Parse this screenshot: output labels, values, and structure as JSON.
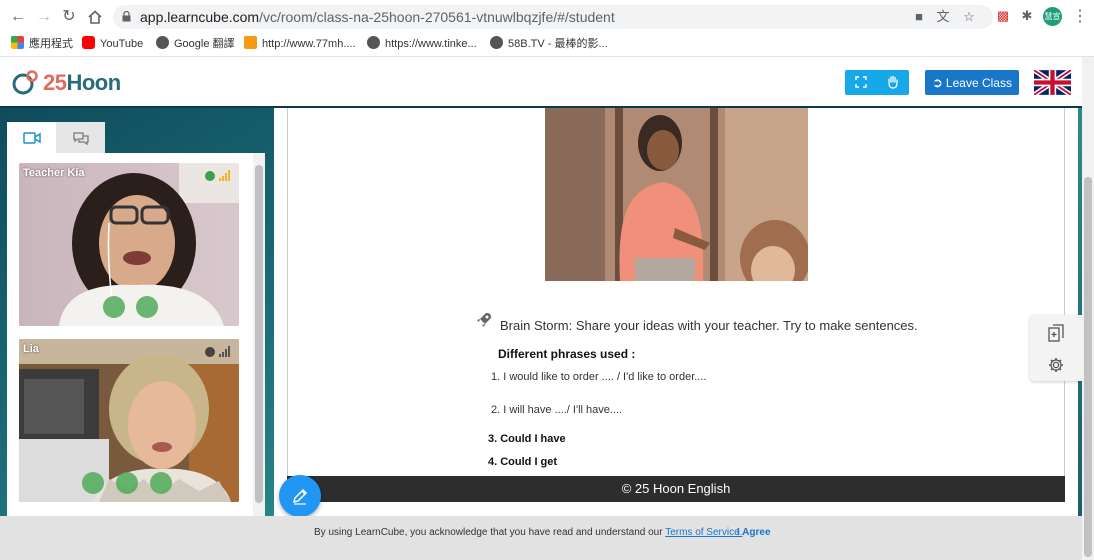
{
  "browser": {
    "url_host": "app.learncube.com",
    "url_path": "/vc/room/class-na-25hoon-270561-vtnuwlbqzjfe/#/student",
    "profile_initials": "慧宣"
  },
  "bookmarks": [
    {
      "label": "應用程式",
      "icon": "apps-grid-icon"
    },
    {
      "label": "YouTube",
      "icon": "youtube-icon"
    },
    {
      "label": "Google 翻譯",
      "icon": "globe-icon"
    },
    {
      "label": "http://www.77mh....",
      "icon": "site-icon"
    },
    {
      "label": "https://www.tinke...",
      "icon": "globe-icon"
    },
    {
      "label": "58B.TV - 最棒的影...",
      "icon": "globe-icon"
    }
  ],
  "header": {
    "logo_num": "25",
    "logo_word": "Hoon",
    "leave_label": "Leave Class"
  },
  "videos": [
    {
      "name": "Teacher Kia"
    },
    {
      "name": "Lia"
    }
  ],
  "slide": {
    "prompt": "Brain Storm: Share your ideas with your teacher. Try to make sentences.",
    "phrases_title": "Different phrases used :",
    "items": [
      "1. I would like to order .... / I'd like to order....",
      "2. I will have ..../ I'll have....",
      "3. Could I have",
      "4. Could I get"
    ],
    "footer": "© 25 Hoon English"
  },
  "consent": {
    "text": "By using LearnCube, you acknowledge that you have read and understand our",
    "link": "Terms of Service.",
    "agree": "I Agree"
  },
  "colors": {
    "accent": "#16a8e9",
    "leave": "#1976c9",
    "logo_red": "#e26b5c",
    "logo_teal": "#2a6b7a"
  }
}
